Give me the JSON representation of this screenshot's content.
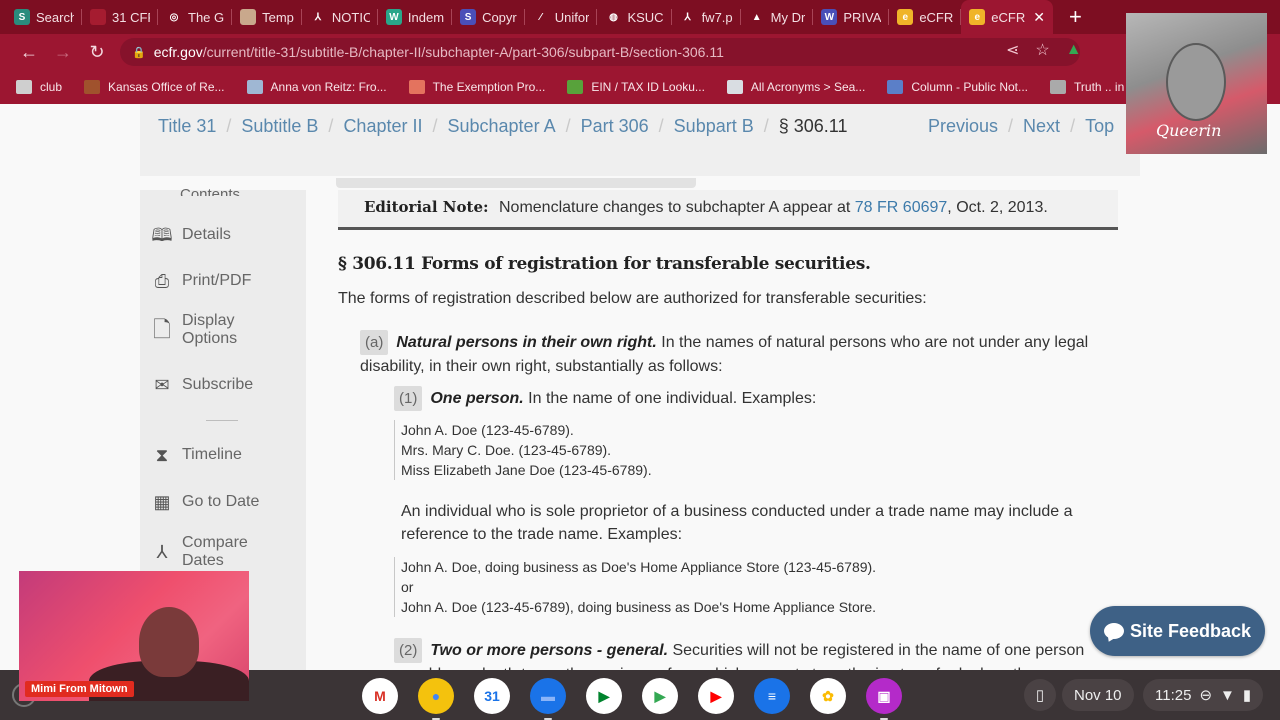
{
  "browser": {
    "tabs": [
      {
        "title": "Search",
        "icon": "search-app-icon",
        "color": "#2a8c7d",
        "glyph": "S"
      },
      {
        "title": "31 CFR",
        "icon": "red-doc-icon",
        "color": "#a51c30",
        "glyph": ""
      },
      {
        "title": "The G",
        "icon": "swirl-icon",
        "color": "#7d0e22",
        "glyph": "◎"
      },
      {
        "title": "Temp",
        "icon": "image-icon",
        "color": "#c9a88c",
        "glyph": ""
      },
      {
        "title": "NOTIC",
        "icon": "pdf-icon",
        "color": "#7d0e22",
        "glyph": "⅄"
      },
      {
        "title": "Indem",
        "icon": "w-icon",
        "color": "#2aa68a",
        "glyph": "W"
      },
      {
        "title": "Copyr",
        "icon": "s-icon",
        "color": "#4a4fb8",
        "glyph": "S"
      },
      {
        "title": "Unifor",
        "icon": "uniform-icon",
        "color": "#7d0e22",
        "glyph": "⁄"
      },
      {
        "title": "KSUC",
        "icon": "globe-icon",
        "color": "#7d0e22",
        "glyph": "◍"
      },
      {
        "title": "fw7.p",
        "icon": "pdf-icon",
        "color": "#7d0e22",
        "glyph": "⅄"
      },
      {
        "title": "My Dr",
        "icon": "drive-icon",
        "color": "#7d0e22",
        "glyph": "▲"
      },
      {
        "title": "PRIVA",
        "icon": "w-icon",
        "color": "#4a4fb8",
        "glyph": "W"
      },
      {
        "title": "eCFR",
        "icon": "ecfr-icon",
        "color": "#f0b429",
        "glyph": "e"
      },
      {
        "title": "eCFR",
        "icon": "ecfr-icon",
        "color": "#f0b429",
        "glyph": "e",
        "active": true
      }
    ],
    "new_tab_label": "+",
    "url_domain": "ecfr.gov",
    "url_path": "/current/title-31/subtitle-B/chapter-II/subchapter-A/part-306/subpart-B/section-306.11",
    "bookmarks": [
      {
        "label": "club",
        "icon": "folder-icon",
        "color": "#cfcfcf"
      },
      {
        "label": "Kansas Office of Re...",
        "icon": "grid-icon",
        "color": "#a0522d"
      },
      {
        "label": "Anna von Reitz: Fro...",
        "icon": "image-icon",
        "color": "#9fb7d3"
      },
      {
        "label": "The Exemption Pro...",
        "icon": "exemption-icon",
        "color": "#e4735e"
      },
      {
        "label": "EIN / TAX ID Looku...",
        "icon": "check-icon",
        "color": "#58a23b"
      },
      {
        "label": "All Acronyms > Sea...",
        "icon": "acronyms-icon",
        "color": "#d9dde2"
      },
      {
        "label": "Column - Public Not...",
        "icon": "column-icon",
        "color": "#5b7fc8"
      },
      {
        "label": "Truth .. in brief",
        "icon": "globe-icon",
        "color": "#aaaaaa"
      }
    ]
  },
  "page": {
    "breadcrumbs": [
      "Title 31",
      "Subtitle B",
      "Chapter II",
      "Subchapter A",
      "Part 306",
      "Subpart B"
    ],
    "current_section": "§ 306.11",
    "pager": [
      "Previous",
      "Next",
      "Top"
    ],
    "sidebar": {
      "top_cut": "Contents",
      "items": [
        {
          "label": "Details",
          "icon": "book-icon",
          "glyph": "📖"
        },
        {
          "label": "Print/PDF",
          "icon": "printer-icon",
          "glyph": "🖶"
        },
        {
          "label": "Display\nOptions",
          "icon": "document-icon",
          "glyph": "🗋"
        },
        {
          "label": "Subscribe",
          "icon": "envelope-icon",
          "glyph": "✉"
        },
        {
          "label": "Timeline",
          "icon": "hourglass-icon",
          "glyph": "⌛"
        },
        {
          "label": "Go to Date",
          "icon": "calendar-icon",
          "glyph": "📅"
        },
        {
          "label": "Compare\nDates",
          "icon": "compare-icon",
          "glyph": "⅄"
        }
      ]
    },
    "editorial_note": {
      "label": "Editorial Note:",
      "text_before": "Nomenclature changes to subchapter A appear at",
      "link": "78 FR 60697",
      "text_after": ", Oct. 2, 2013."
    },
    "section_title": "§ 306.11 Forms of registration for transferable securities.",
    "intro": "The forms of registration described below are authorized for transferable securities:",
    "para_a": {
      "marker": "(a)",
      "heading": "Natural persons in their own right.",
      "text": "In the names of natural persons who are not under any legal disability, in their own right, substantially as follows:"
    },
    "para_1": {
      "marker": "(1)",
      "heading": "One person.",
      "text": "In the name of one individual. Examples:"
    },
    "examples_1": [
      "John A. Doe (123-45-6789).",
      "Mrs. Mary C. Doe. (123-45-6789).",
      "Miss Elizabeth Jane Doe (123-45-6789)."
    ],
    "sole_proprietor": "An individual who is sole proprietor of a business conducted under a trade name may include a reference to the trade name. Examples:",
    "examples_2": [
      "John A. Doe, doing business as Doe's Home Appliance Store (123-45-6789).",
      "or",
      "John A. Doe (123-45-6789), doing business as Doe's Home Appliance Store."
    ],
    "para_2": {
      "marker": "(2)",
      "heading": "Two or more persons - general.",
      "text": "Securities will not be registered in the name of one person payable on death to another, or in any form which purports to authorize transfer by less than"
    },
    "feedback_label": "Site Feedback"
  },
  "overlays": {
    "webcam_name": "Mimi From Mitown",
    "brand_signature": "Queerin"
  },
  "shelf": {
    "apps": [
      {
        "name": "gmail-icon",
        "glyph": "M",
        "bg": "#ffffff",
        "fg": "#d93025"
      },
      {
        "name": "chrome-icon",
        "glyph": "●",
        "bg": "#f4c20d",
        "fg": "#4285f4",
        "active": true
      },
      {
        "name": "calendar-app-icon",
        "glyph": "31",
        "bg": "#ffffff",
        "fg": "#1a73e8"
      },
      {
        "name": "files-icon",
        "glyph": "▬",
        "bg": "#1a73e8",
        "fg": "#8ab4f8",
        "active": true
      },
      {
        "name": "meet-icon",
        "glyph": "▶",
        "bg": "#ffffff",
        "fg": "#00832d"
      },
      {
        "name": "play-store-icon",
        "glyph": "▶",
        "bg": "#ffffff",
        "fg": "#34a853"
      },
      {
        "name": "youtube-icon",
        "glyph": "▶",
        "bg": "#ffffff",
        "fg": "#ff0000"
      },
      {
        "name": "messages-icon",
        "glyph": "≡",
        "bg": "#1a73e8",
        "fg": "#ffffff"
      },
      {
        "name": "photos-icon",
        "glyph": "✿",
        "bg": "#ffffff",
        "fg": "#fbbc04"
      },
      {
        "name": "screencast-icon",
        "glyph": "▣",
        "bg": "#b42ac9",
        "fg": "#ffffff",
        "active": true
      }
    ],
    "date": "Nov 10",
    "time": "11:25"
  }
}
